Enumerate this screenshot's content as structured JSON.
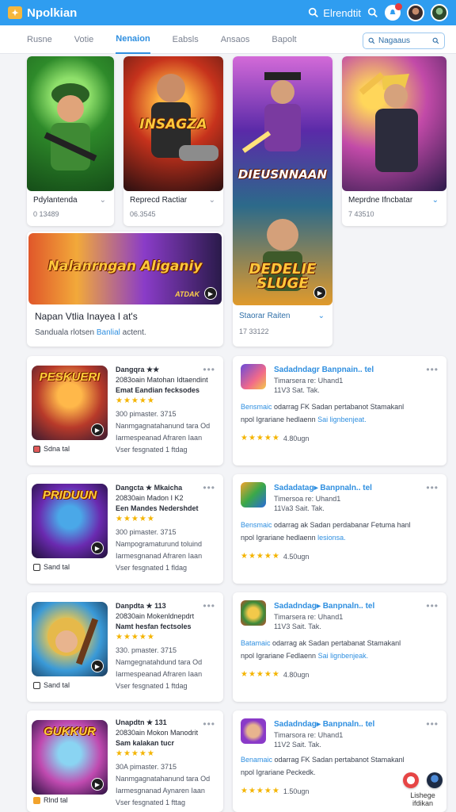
{
  "header": {
    "logo_glyph": "✦",
    "title": "Npolkian",
    "search_label": "Elrendtit",
    "search_icon": "search-icon",
    "brand_color": "#2f9df0"
  },
  "tabs": [
    {
      "label": "Rusne"
    },
    {
      "label": "Votie"
    },
    {
      "label": "Nenaion",
      "active": true
    },
    {
      "label": "Eabsls"
    },
    {
      "label": "Ansaos"
    },
    {
      "label": "Bapolt"
    }
  ],
  "tab_search": {
    "label": "Nagaaus"
  },
  "featured": [
    {
      "art_text": "",
      "label": "Pdylantenda",
      "sub": "0 13489"
    },
    {
      "art_text": "INSAGZA",
      "label": "Reprecd Ractiar",
      "sub": "06.3545"
    },
    {
      "art_text_top": "DIEUSNNAAN",
      "art_text_bottom": "DEDELIE SLUGE",
      "label": "Staorar Raiten",
      "sub": "17 33122"
    },
    {
      "art_text": "",
      "label": "Meprdne Ifncbatar",
      "sub": "7 43510"
    }
  ],
  "banner": {
    "art_text": "Nalanrngan Aliganiy",
    "corner_text": "ATDAK",
    "title": "Napan Vtlia Inayea I at's",
    "desc_prefix": "Sanduala rlotsen ",
    "desc_highlight": "Banlial",
    "desc_suffix": " actent."
  },
  "games": [
    {
      "thumb_text": "PESKUERI",
      "title": "Dangqra ★★",
      "line2": "2083oain Matohan Idtaendint",
      "line3": "Emat Eandian fecksodes",
      "stars": "★★★★★",
      "line4": "300 pimaster. 3715",
      "line5": "Nanmgagnatahanund tara Od",
      "line6": "Iarmespeanad Afraren Iaan",
      "line7": "Vser fesgnated 1 ftdag",
      "foot": "Sdna tal"
    },
    {
      "thumb_text": "PRIDUUN",
      "title": "Dangcta ★ Mkaicha",
      "line2": "20830ain Madon I K2",
      "line3": "Een Mandes Nedershdet",
      "stars": "★★★★★",
      "line4": "300 pimaster. 3715",
      "line5": "Nampogramaturund toluind",
      "line6": "Iarmesgnanad Afraren Iaan",
      "line7": "Vser fesgnated 1 fldag",
      "foot": "Sand tal"
    },
    {
      "thumb_text": "",
      "title": "Danpdta ★ 113",
      "line2": "20830ain Mokenldnepdrt",
      "line3": "Namt hesfan fectsoles",
      "stars": "★★★★★",
      "line4": "330. pmaster. 3715",
      "line5": "Namgegnatahdund tara Od",
      "line6": "Iarmespeanad Afraren Iaan",
      "line7": "Vser fesgnated 1 ftdag",
      "foot": "Sand tal"
    },
    {
      "thumb_text": "GUKKUR",
      "title": "Unapdtn ★ 131",
      "line2": "20830ain Mokon Manodrit",
      "line3": "Sam kalakan tucr",
      "stars": "★★★★★",
      "line4": "30A pimaster. 3715",
      "line5": "Nanmgagnatahanund tara Od",
      "line6": "Iarmesgnanad Aynaren Iaan",
      "line7": "Vser fesgnated 1 fttag",
      "foot": "Rlnd tal"
    }
  ],
  "reviews": [
    {
      "title": "Sadadndagr Banpnain.. tel",
      "sub1": "Timarsera re: Uhand1",
      "sub2": "11V3 Sat. Tak.",
      "desc1_hl": "Bensmaic",
      "desc1": " odarrag FK Sadan pertabanot Stamakanl",
      "desc2": "npol Igrariane hedlaenn ",
      "desc2_hl": "Sai lignbenjeat.",
      "stars": "★★★★★",
      "count": "4.80ugn"
    },
    {
      "title": "Sadadatag▸ Banpnaln.. tel",
      "sub1": "Timersoa re: Uhand1",
      "sub2": "11\\/a3 Sait. Tak.",
      "desc1_hl": "Bensmaic",
      "desc1": " odarrag ak Sadan perdabanar Fetuma hanl",
      "desc2": "npol Igrariane hedlaenn ",
      "desc2_hl": "lesionsa.",
      "stars": "★★★★★",
      "count": "4.50ugn"
    },
    {
      "title": "Sadadndag▸ Banpnaln.. tel",
      "sub1": "Timarsera re: Uhand1",
      "sub2": "11V3 Sait. Tak.",
      "desc1_hl": "Batamaic",
      "desc1": " odarrag ak Sadan pertabanat Stamakanl",
      "desc2": "npol Igrariane Fedlaenn ",
      "desc2_hl": "Sai lignbenjeak.",
      "stars": "★★★★★",
      "count": "4.80ugn"
    },
    {
      "title": "Sadadndag▸ Banpnaln.. tel",
      "sub1": "Timarsora re: Uhand1",
      "sub2": "11V2 Sait. Tak.",
      "desc1_hl": "Benamaic",
      "desc1": " odarrag FK Sadan pertabanot Stamakanl",
      "desc2": "npol Igrariane Peckedk.",
      "desc2_hl": "",
      "stars": "★★★★★",
      "count": "1.50ugn"
    }
  ],
  "bottom": {
    "label": "Lishege ifdikan"
  }
}
